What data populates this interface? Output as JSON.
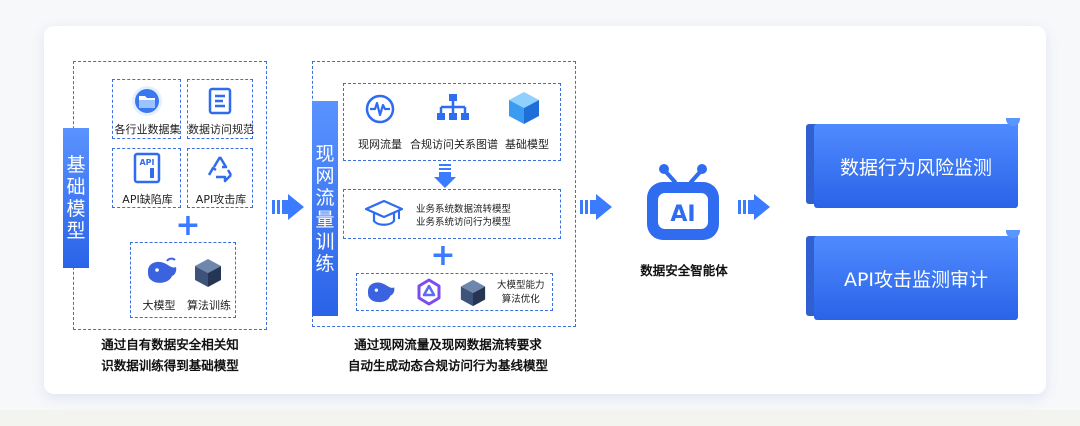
{
  "left_group": {
    "vertical_label": "基础模型",
    "items": [
      {
        "label": "各行业数据集",
        "icon": "folder-icon"
      },
      {
        "label": "数据访问规范",
        "icon": "document-icon"
      },
      {
        "label": "API缺陷库",
        "icon": "api-file-icon"
      },
      {
        "label": "API攻击库",
        "icon": "recycle-icon"
      }
    ],
    "bottom_items": [
      {
        "label": "大模型",
        "icon": "whale-icon"
      },
      {
        "label": "算法训练",
        "icon": "cube-icon"
      }
    ],
    "caption_line1": "通过自有数据安全相关知",
    "caption_line2": "识数据训练得到基础模型"
  },
  "middle_group": {
    "vertical_label": "现网流量训练",
    "top_items": [
      {
        "label": "现网流量",
        "icon": "waveform-icon"
      },
      {
        "label": "合规访问关系图谱",
        "icon": "hierarchy-icon"
      },
      {
        "label": "基础模型",
        "icon": "cube-icon"
      }
    ],
    "model_line1": "业务系统数据流转模型",
    "model_line2": "业务系统访问行为模型",
    "bottom_label_line1": "大模型能力",
    "bottom_label_line2": "算法优化",
    "caption_line1": "通过现网流量及现网数据流转要求",
    "caption_line2": "自动生成动态合规访问行为基线模型"
  },
  "agent": {
    "icon_text": "AI",
    "label": "数据安全智能体"
  },
  "outputs": [
    {
      "label": "数据行为风险监测"
    },
    {
      "label": "API攻击监测审计"
    }
  ],
  "colors": {
    "primary": "#2a63e8",
    "accent": "#3b7bff",
    "text": "#111111"
  }
}
